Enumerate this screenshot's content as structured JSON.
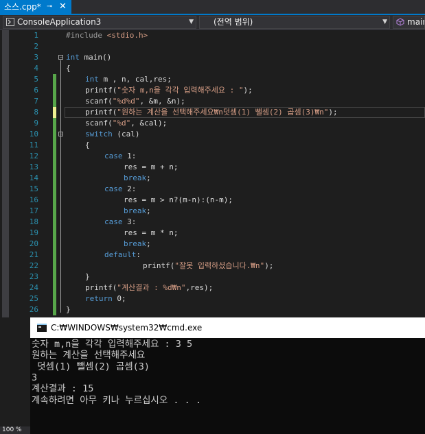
{
  "tab": {
    "title": "소스.cpp*",
    "pin_glyph": "⊸",
    "close_glyph": "✕"
  },
  "nav": {
    "project": "ConsoleApplication3",
    "scope": "(전역 범위)",
    "member": "main"
  },
  "editor": {
    "lines": [
      {
        "n": "1",
        "html": "<span class=\"pp\">#include</span> <span class=\"inc\">&lt;stdio.h&gt;</span>",
        "indent": 0
      },
      {
        "n": "2",
        "html": "",
        "indent": 0
      },
      {
        "n": "3",
        "html": "<span class=\"kw\">int</span> main()",
        "indent": 0
      },
      {
        "n": "4",
        "html": "{",
        "indent": 0
      },
      {
        "n": "5",
        "html": "<span class=\"kw\">int</span> m , n, cal,res;",
        "indent": 1
      },
      {
        "n": "6",
        "html": "printf(<span class=\"str\">\"숫자 m,n을 각각 입력해주세요 : \"</span>);",
        "indent": 1
      },
      {
        "n": "7",
        "html": "scanf(<span class=\"str\">\"%d%d\"</span>, &amp;m, &amp;n);",
        "indent": 1
      },
      {
        "n": "8",
        "html": "printf(<span class=\"str\">\"원하는 계산을 선택해주세요₩n덧셈(1) 뺄셈(2) 곱셈(3)₩n\"</span>);",
        "indent": 1
      },
      {
        "n": "9",
        "html": "scanf(<span class=\"str\">\"%d\"</span>, &amp;cal);",
        "indent": 1
      },
      {
        "n": "10",
        "html": "<span class=\"kw\">switch</span> (cal)",
        "indent": 1
      },
      {
        "n": "11",
        "html": "{",
        "indent": 1
      },
      {
        "n": "12",
        "html": "<span class=\"kw\">case</span> 1:",
        "indent": 2
      },
      {
        "n": "13",
        "html": "res = m + n;",
        "indent": 3
      },
      {
        "n": "14",
        "html": "<span class=\"kw\">break</span>;",
        "indent": 3
      },
      {
        "n": "15",
        "html": "<span class=\"kw\">case</span> 2:",
        "indent": 2
      },
      {
        "n": "16",
        "html": "res = m &gt; n?(m-n):(n-m);",
        "indent": 3
      },
      {
        "n": "17",
        "html": "<span class=\"kw\">break</span>;",
        "indent": 3
      },
      {
        "n": "18",
        "html": "<span class=\"kw\">case</span> 3:",
        "indent": 2
      },
      {
        "n": "19",
        "html": "res = m * n;",
        "indent": 3
      },
      {
        "n": "20",
        "html": "<span class=\"kw\">break</span>;",
        "indent": 3
      },
      {
        "n": "21",
        "html": "<span class=\"kw\">default</span>:",
        "indent": 2
      },
      {
        "n": "22",
        "html": "printf(<span class=\"str\">\"잘못 입력하셨습니다.₩n\"</span>);",
        "indent": 4
      },
      {
        "n": "23",
        "html": "}",
        "indent": 1
      },
      {
        "n": "24",
        "html": "printf(<span class=\"str\">\"계산결과 : %d₩n\"</span>,res);",
        "indent": 1
      },
      {
        "n": "25",
        "html": "<span class=\"kw\">return</span> 0;",
        "indent": 1
      },
      {
        "n": "26",
        "html": "}",
        "indent": 0
      }
    ]
  },
  "console": {
    "title": "C:₩WINDOWS₩system32₩cmd.exe",
    "lines": [
      "숫자 m,n을 각각 입력해주세요 : 3 5",
      "원하는 계산을 선택해주세요",
      " 덧셈(1) 뺄셈(2) 곱셈(3)",
      "3",
      "계산결과 : 15",
      "계속하려면 아무 키나 누르십시오 . . ."
    ]
  },
  "zoom": "100 %",
  "colors": {
    "accent": "#007acc",
    "keyword": "#569cd6",
    "string": "#d69d85",
    "line_number": "#2b91af",
    "change_saved": "#57a64a",
    "change_unsaved": "#efef91"
  }
}
